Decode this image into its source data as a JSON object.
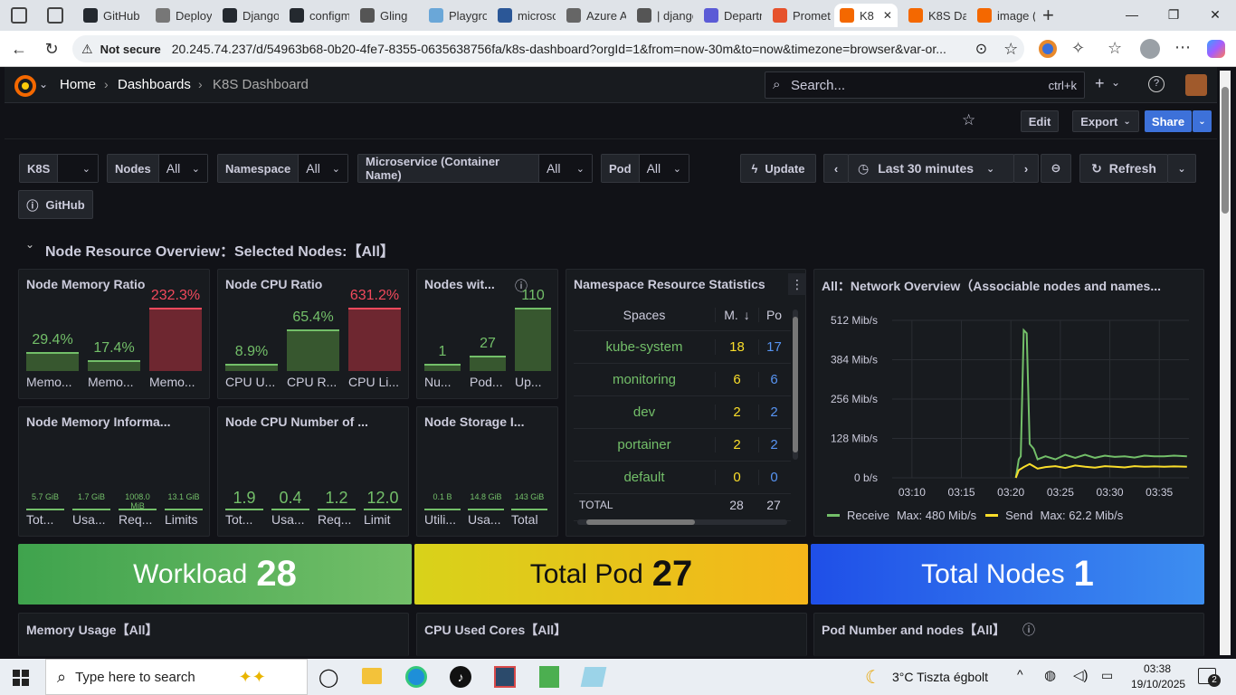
{
  "browser": {
    "tabs": [
      {
        "label": "GitHub",
        "color": "#24292f"
      },
      {
        "label": "Deployi",
        "color": "#777"
      },
      {
        "label": "Django",
        "color": "#24292f"
      },
      {
        "label": "configm",
        "color": "#24292f"
      },
      {
        "label": "Gling",
        "color": "#555"
      },
      {
        "label": "Playgro",
        "color": "#6aa7d8"
      },
      {
        "label": "microso",
        "color": "#2b5797"
      },
      {
        "label": "Azure A",
        "color": "#666"
      },
      {
        "label": "| djangc",
        "color": "#555"
      },
      {
        "label": "Departn",
        "color": "#5b5bd6"
      },
      {
        "label": "Promet",
        "color": "#e6522c"
      },
      {
        "label": "K8",
        "color": "#f46800"
      },
      {
        "label": "K8S Da",
        "color": "#f46800"
      },
      {
        "label": "image (",
        "color": "#f46800"
      }
    ],
    "security": "Not secure",
    "url": "20.245.74.237/d/54963b68-0b20-4fe7-8355-0635638756fa/k8s-dashboard?orgId=1&from=now-30m&to=now&timezone=browser&var-or..."
  },
  "grafana": {
    "breadcrumb": [
      "Home",
      "Dashboards",
      "K8S Dashboard"
    ],
    "search_placeholder": "Search...",
    "search_shortcut": "ctrl+k",
    "edit": "Edit",
    "export": "Export",
    "share": "Share",
    "vars": [
      {
        "label": "K8S",
        "value": ""
      },
      {
        "label": "Nodes",
        "value": "All"
      },
      {
        "label": "Namespace",
        "value": "All"
      },
      {
        "label": "Microservice (Container Name)",
        "value": "All"
      },
      {
        "label": "Pod",
        "value": "All"
      }
    ],
    "update": "Update",
    "timerange": "Last 30 minutes",
    "refresh": "Refresh",
    "github": "GitHub",
    "row_title": "Node Resource Overview：Selected Nodes:【All】"
  },
  "panels": {
    "mem_ratio": {
      "title": "Node Memory Ratio",
      "bars": [
        {
          "value": "29.4%",
          "label": "Memo...",
          "pct": 29.4,
          "color": "#73bf69"
        },
        {
          "value": "17.4%",
          "label": "Memo...",
          "pct": 17.4,
          "color": "#73bf69"
        },
        {
          "value": "232.3%",
          "label": "Memo...",
          "pct": 232.3,
          "color": "#f2495c"
        }
      ]
    },
    "cpu_ratio": {
      "title": "Node CPU Ratio",
      "bars": [
        {
          "value": "8.9%",
          "label": "CPU U...",
          "pct": 8.9,
          "color": "#73bf69"
        },
        {
          "value": "65.4%",
          "label": "CPU R...",
          "pct": 65.4,
          "color": "#73bf69"
        },
        {
          "value": "631.2%",
          "label": "CPU Li...",
          "pct": 631.2,
          "color": "#f2495c"
        }
      ]
    },
    "nodes": {
      "title": "Nodes wit...",
      "bars": [
        {
          "value": "1",
          "label": "Nu...",
          "pct": 1,
          "color": "#73bf69"
        },
        {
          "value": "27",
          "label": "Pod...",
          "pct": 27,
          "color": "#73bf69"
        },
        {
          "value": "110",
          "label": "Up...",
          "pct": 110,
          "color": "#73bf69"
        }
      ]
    },
    "mem_info": {
      "title": "Node Memory Informa...",
      "items": [
        {
          "value": "5.7 GiB",
          "label": "Tot..."
        },
        {
          "value": "1.7 GiB",
          "label": "Usa..."
        },
        {
          "value": "1008.0 MiB",
          "label": "Req..."
        },
        {
          "value": "13.1 GiB",
          "label": "Limits"
        }
      ]
    },
    "cpu_num": {
      "title": "Node CPU Number of ...",
      "items": [
        {
          "value": "1.9",
          "label": "Tot..."
        },
        {
          "value": "0.4",
          "label": "Usa..."
        },
        {
          "value": "1.2",
          "label": "Req..."
        },
        {
          "value": "12.0",
          "label": "Limit"
        }
      ]
    },
    "storage": {
      "title": "Node Storage I...",
      "items": [
        {
          "value": "0.1 B",
          "label": "Utili..."
        },
        {
          "value": "14.8 GiB",
          "label": "Usa..."
        },
        {
          "value": "143 GiB",
          "label": "Total"
        }
      ]
    },
    "ns_stats": {
      "title": "Namespace Resource Statistics",
      "headers": [
        "Spaces",
        "M.",
        "Po"
      ],
      "rows": [
        [
          "kube-system",
          "18",
          "17"
        ],
        [
          "monitoring",
          "6",
          "6"
        ],
        [
          "dev",
          "2",
          "2"
        ],
        [
          "portainer",
          "2",
          "2"
        ],
        [
          "default",
          "0",
          "0"
        ]
      ],
      "total": [
        "TOTAL",
        "28",
        "27"
      ]
    },
    "network": {
      "title": "All：Network Overview（Associable nodes and names...",
      "legend": [
        {
          "name": "Receive",
          "max": "Max: 480 Mib/s",
          "color": "#73bf69"
        },
        {
          "name": "Send",
          "max": "Max: 62.2 Mib/s",
          "color": "#fade2a"
        }
      ]
    },
    "workload": {
      "label": "Workload",
      "value": "28"
    },
    "total_pod": {
      "label": "Total Pod",
      "value": "27"
    },
    "total_nodes": {
      "label": "Total Nodes",
      "value": "1"
    },
    "mem_usage": {
      "title": "Memory Usage【All】"
    },
    "cpu_cores": {
      "title": "CPU Used Cores【All】"
    },
    "pod_number": {
      "title": "Pod Number and nodes【All】"
    }
  },
  "chart_data": {
    "type": "line",
    "x": [
      "03:10",
      "03:15",
      "03:20",
      "03:25",
      "03:30",
      "03:35"
    ],
    "yticks": [
      "512 Mib/s",
      "384 Mib/s",
      "256 Mib/s",
      "128 Mib/s",
      "0 b/s"
    ],
    "ylim": [
      0,
      512
    ],
    "series": [
      {
        "name": "Receive",
        "points": [
          [
            20.5,
            0
          ],
          [
            20.8,
            60
          ],
          [
            21.0,
            70
          ],
          [
            21.3,
            480
          ],
          [
            21.6,
            470
          ],
          [
            21.9,
            110
          ],
          [
            22.3,
            95
          ],
          [
            22.7,
            60
          ],
          [
            23.5,
            70
          ],
          [
            24.5,
            60
          ],
          [
            25.5,
            75
          ],
          [
            26.5,
            65
          ],
          [
            27.5,
            75
          ],
          [
            28.5,
            65
          ],
          [
            29.5,
            72
          ],
          [
            30.5,
            68
          ],
          [
            31.5,
            70
          ],
          [
            32.5,
            66
          ],
          [
            33.5,
            72
          ],
          [
            34.5,
            70
          ],
          [
            35.5,
            70
          ],
          [
            36.5,
            72
          ],
          [
            37.8,
            70
          ]
        ]
      },
      {
        "name": "Send",
        "points": [
          [
            20.5,
            0
          ],
          [
            20.8,
            25
          ],
          [
            21.3,
            35
          ],
          [
            21.9,
            45
          ],
          [
            22.7,
            30
          ],
          [
            23.5,
            35
          ],
          [
            24.5,
            38
          ],
          [
            25.5,
            32
          ],
          [
            26.5,
            40
          ],
          [
            27.5,
            36
          ],
          [
            28.5,
            33
          ],
          [
            29.5,
            38
          ],
          [
            30.5,
            36
          ],
          [
            31.5,
            34
          ],
          [
            32.5,
            38
          ],
          [
            33.5,
            36
          ],
          [
            34.5,
            37
          ],
          [
            35.5,
            36
          ],
          [
            36.5,
            37
          ],
          [
            37.8,
            36
          ]
        ]
      }
    ]
  },
  "taskbar": {
    "search": "Type here to search",
    "weather": "3°C  Tiszta égbolt",
    "time": "03:38",
    "date": "19/10/2025",
    "notif": "2"
  }
}
